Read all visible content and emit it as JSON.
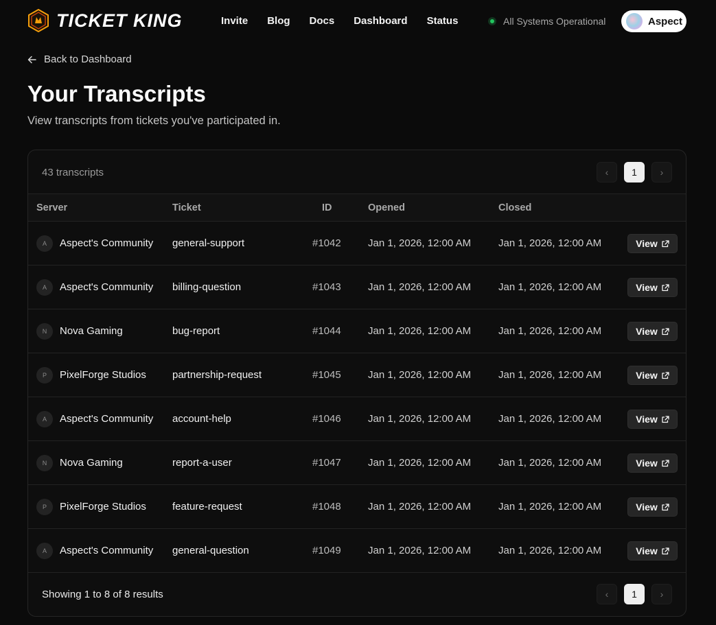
{
  "header": {
    "brand": "TICKET KING",
    "nav": [
      "Invite",
      "Blog",
      "Docs",
      "Dashboard",
      "Status"
    ],
    "status_text": "All Systems Operational",
    "user_name": "Aspect"
  },
  "back_link": "Back to Dashboard",
  "page": {
    "title": "Your Transcripts",
    "subtitle": "View transcripts from tickets you've participated in."
  },
  "card": {
    "count_label": "43 transcripts",
    "pagination": {
      "prev": "‹",
      "current": "1",
      "next": "›"
    },
    "columns": [
      "Server",
      "Ticket",
      "ID",
      "Opened",
      "Closed"
    ],
    "view_label": "View",
    "showing": "Showing 1 to 8 of 8 results"
  },
  "rows": [
    {
      "initial": "A",
      "server": "Aspect's Community",
      "ticket": "general-support",
      "id": "#1042",
      "opened": "Jan 1, 2026, 12:00 AM",
      "closed": "Jan 1, 2026, 12:00 AM"
    },
    {
      "initial": "A",
      "server": "Aspect's Community",
      "ticket": "billing-question",
      "id": "#1043",
      "opened": "Jan 1, 2026, 12:00 AM",
      "closed": "Jan 1, 2026, 12:00 AM"
    },
    {
      "initial": "N",
      "server": "Nova Gaming",
      "ticket": "bug-report",
      "id": "#1044",
      "opened": "Jan 1, 2026, 12:00 AM",
      "closed": "Jan 1, 2026, 12:00 AM"
    },
    {
      "initial": "P",
      "server": "PixelForge Studios",
      "ticket": "partnership-request",
      "id": "#1045",
      "opened": "Jan 1, 2026, 12:00 AM",
      "closed": "Jan 1, 2026, 12:00 AM"
    },
    {
      "initial": "A",
      "server": "Aspect's Community",
      "ticket": "account-help",
      "id": "#1046",
      "opened": "Jan 1, 2026, 12:00 AM",
      "closed": "Jan 1, 2026, 12:00 AM"
    },
    {
      "initial": "N",
      "server": "Nova Gaming",
      "ticket": "report-a-user",
      "id": "#1047",
      "opened": "Jan 1, 2026, 12:00 AM",
      "closed": "Jan 1, 2026, 12:00 AM"
    },
    {
      "initial": "P",
      "server": "PixelForge Studios",
      "ticket": "feature-request",
      "id": "#1048",
      "opened": "Jan 1, 2026, 12:00 AM",
      "closed": "Jan 1, 2026, 12:00 AM"
    },
    {
      "initial": "A",
      "server": "Aspect's Community",
      "ticket": "general-question",
      "id": "#1049",
      "opened": "Jan 1, 2026, 12:00 AM",
      "closed": "Jan 1, 2026, 12:00 AM"
    }
  ],
  "colors": {
    "background": "#0b0b0b",
    "status_green": "#22c55e",
    "logo_accent": "#f59e0b"
  }
}
